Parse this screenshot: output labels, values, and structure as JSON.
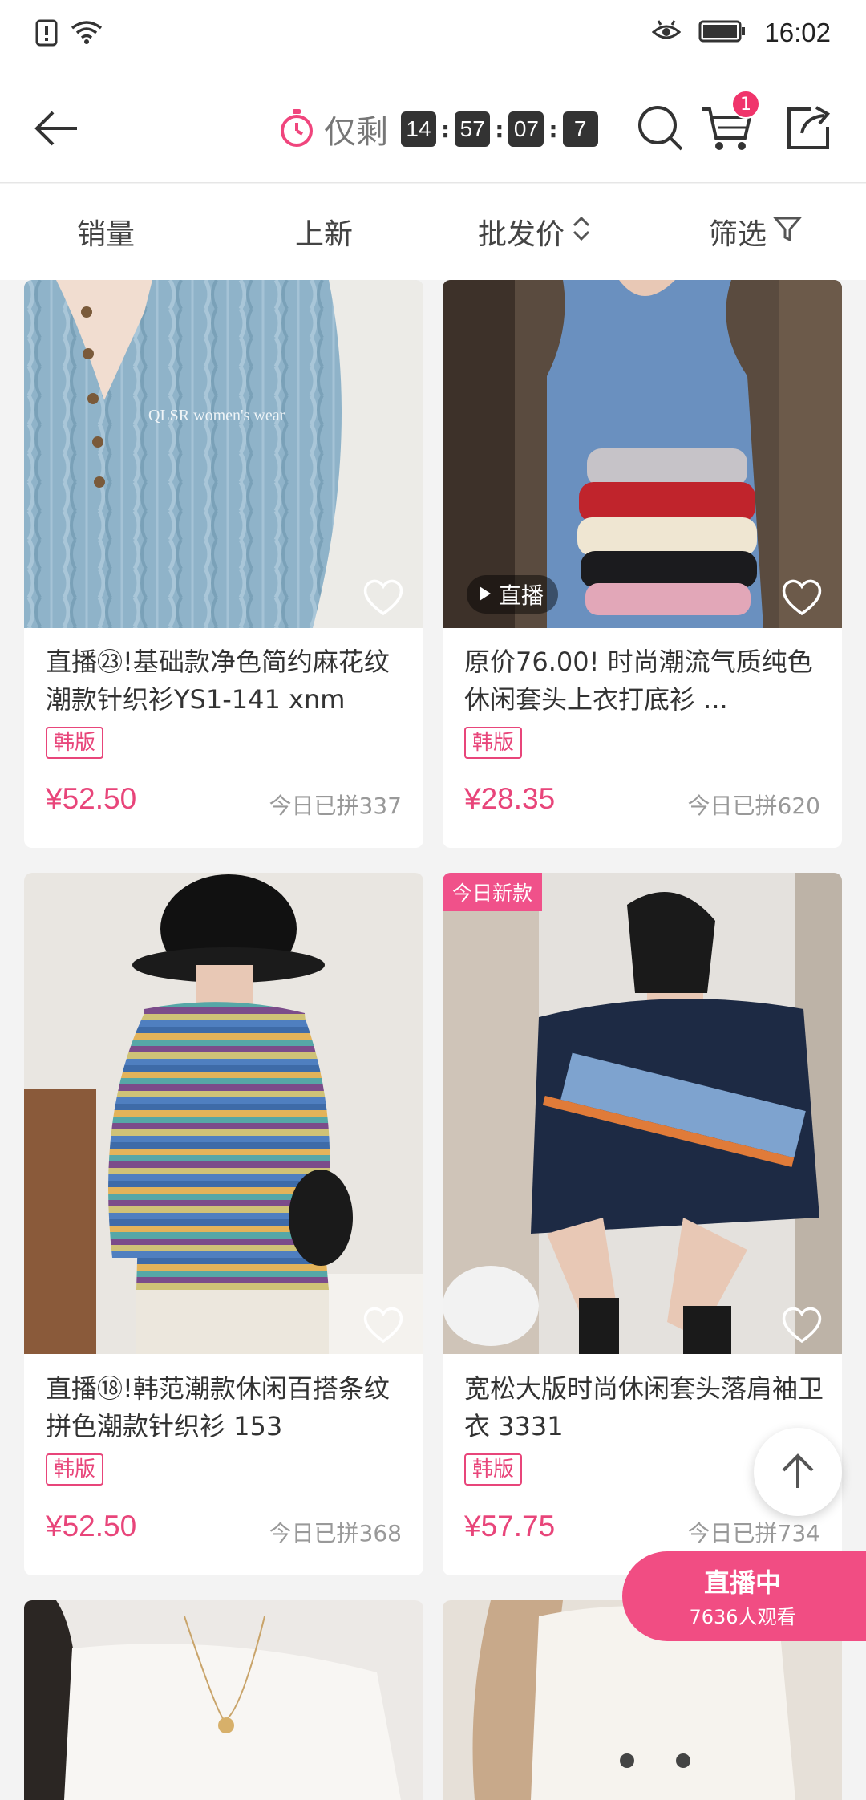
{
  "status_bar": {
    "time": "16:02",
    "icons": [
      "alert-icon",
      "wifi-icon",
      "eye-care-icon",
      "battery-icon"
    ]
  },
  "header": {
    "countdown_label": "仅剩",
    "countdown": [
      "14",
      "57",
      "07",
      "7"
    ],
    "cart_badge": "1",
    "icons": [
      "back-arrow-icon",
      "timer-icon",
      "search-icon",
      "cart-icon",
      "share-icon"
    ]
  },
  "sort_bar": {
    "items": [
      "销量",
      "上新",
      "批发价",
      "筛选"
    ]
  },
  "products": [
    {
      "title": "直播㉓!基础款净色简约麻花纹潮款针织衫YS1-141  xnm",
      "tag": "韩版",
      "price": "¥52.50",
      "sold": "今日已拼337",
      "watermark": "QLSR  women's  wear"
    },
    {
      "title": "原价76.00! 时尚潮流气质纯色休闲套头上衣打底衫 ...",
      "tag": "韩版",
      "price": "¥28.35",
      "sold": "今日已拼620",
      "live_chip": "直播"
    },
    {
      "title": "直播⑱!韩范潮款休闲百搭条纹拼色潮款针织衫 153",
      "tag": "韩版",
      "price": "¥52.50",
      "sold": "今日已拼368"
    },
    {
      "title": "宽松大版时尚休闲套头落肩袖卫衣 3331",
      "tag": "韩版",
      "price": "¥57.75",
      "sold": "今日已拼734",
      "new_badge": "今日新款"
    }
  ],
  "live_float": {
    "title": "直播中",
    "viewers": "7636人观看"
  },
  "colors": {
    "accent": "#e8457a",
    "live_bg": "#f14d83",
    "badge": "#f0346b"
  }
}
